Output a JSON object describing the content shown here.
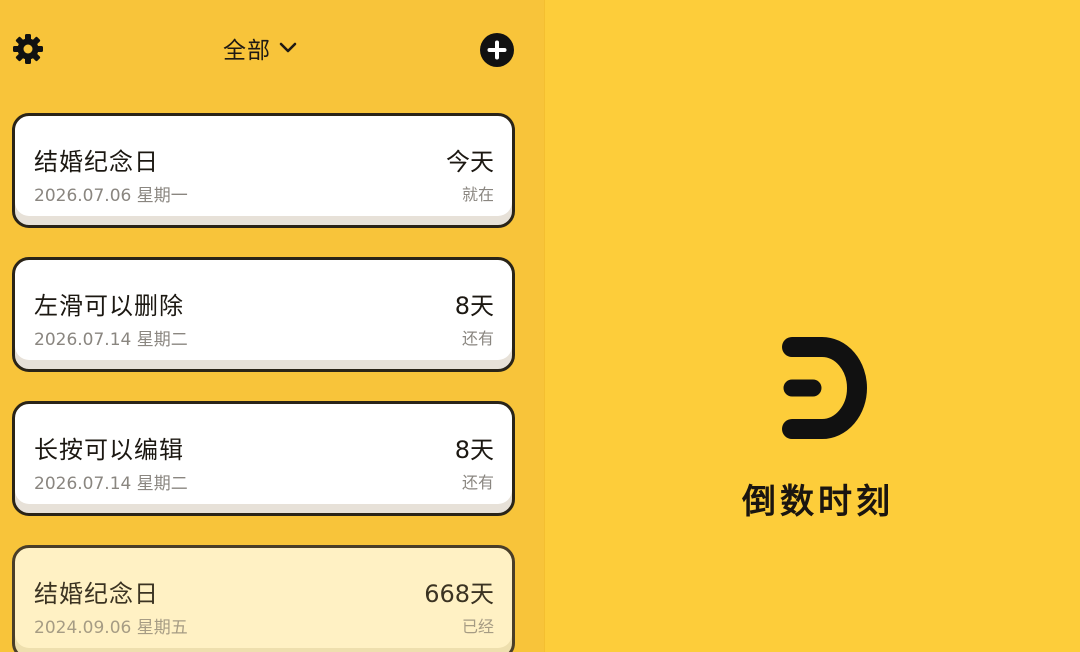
{
  "topbar": {
    "settings_icon": "gear-icon",
    "filter_label": "全部",
    "filter_icon": "chevron-down-icon",
    "add_icon": "plus-circle-icon"
  },
  "events": [
    {
      "title": "结婚纪念日",
      "date": "2026.07.06 星期一",
      "count": "今天",
      "status": "就在",
      "state": "today"
    },
    {
      "title": "左滑可以删除",
      "date": "2026.07.14 星期二",
      "count": "8天",
      "status": "还有",
      "state": "future"
    },
    {
      "title": "长按可以编辑",
      "date": "2026.07.14 星期二",
      "count": "8天",
      "status": "还有",
      "state": "future"
    },
    {
      "title": "结婚纪念日",
      "date": "2024.09.06 星期五",
      "count": "668天",
      "status": "已经",
      "state": "past"
    }
  ],
  "splash": {
    "logo_icon": "app-logo-icon",
    "app_name": "倒数时刻"
  },
  "colors": {
    "background": "#f8c43a",
    "splash_background": "#fdcd3a",
    "card": "#ffffff",
    "past_card": "#fff1c4",
    "text": "#1c1812",
    "muted_text": "#8a8680"
  }
}
